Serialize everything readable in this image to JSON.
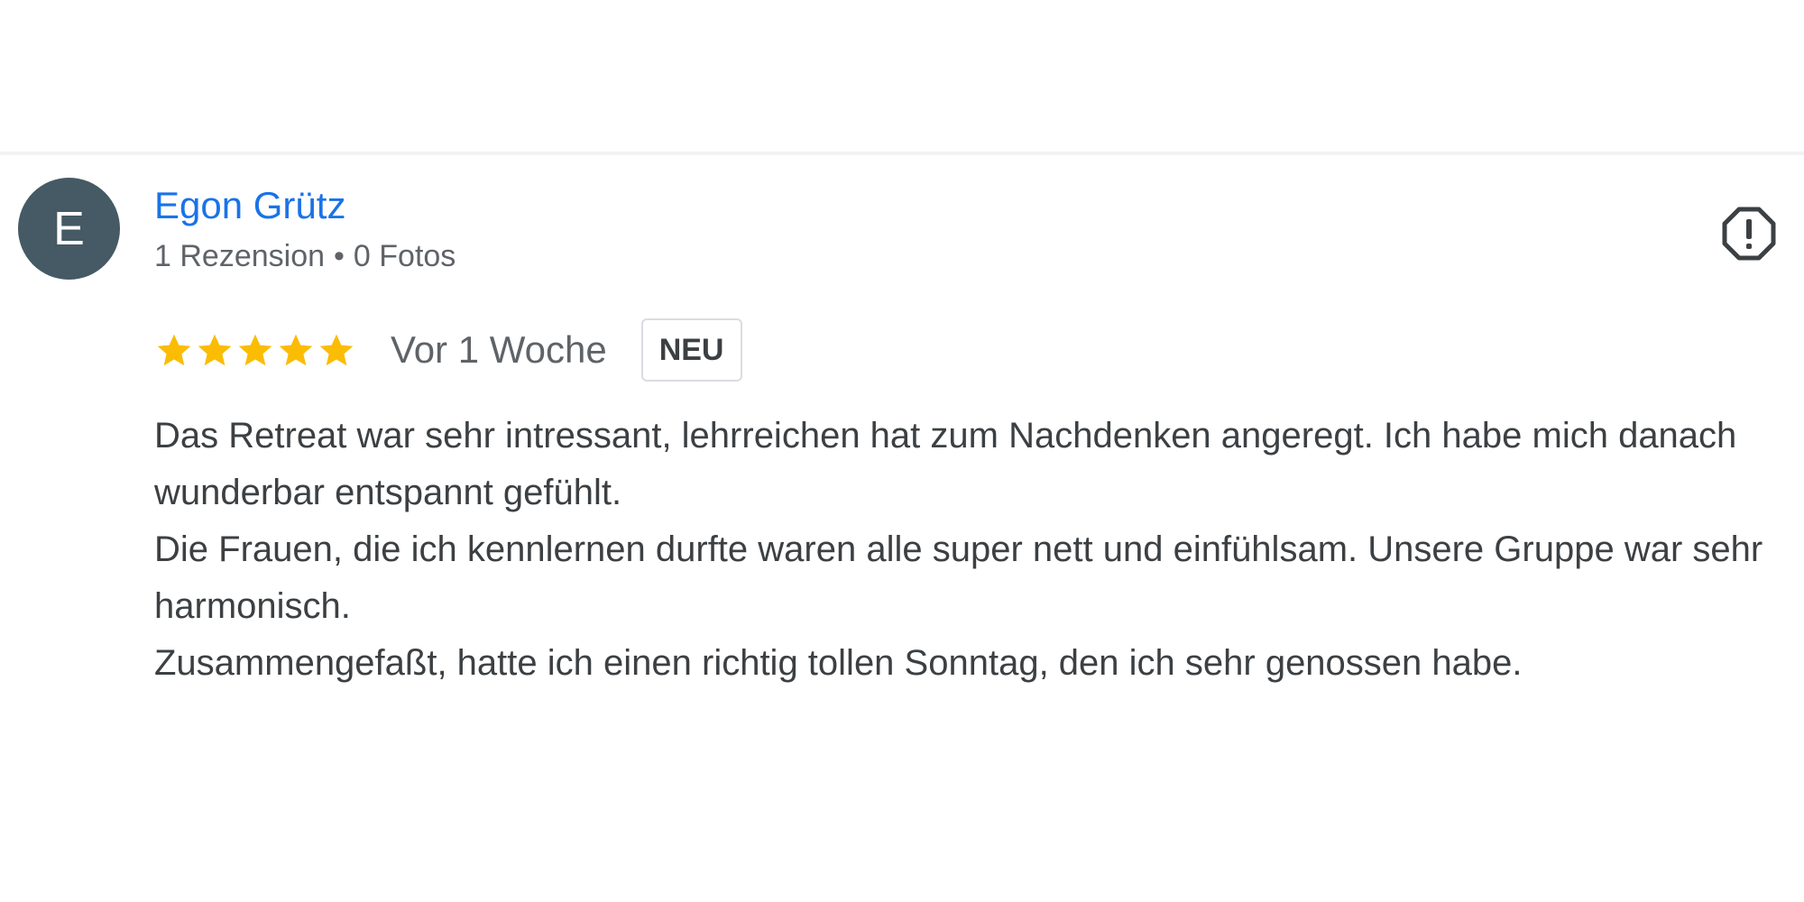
{
  "reviewer": {
    "initial": "E",
    "name": "Egon Grütz",
    "reviews_count": "1 Rezension",
    "separator": "•",
    "photos_count": "0 Fotos",
    "avatar_color": "#455a64"
  },
  "review": {
    "rating": 5,
    "max_rating": 5,
    "star_color": "#fbbc04",
    "date": "Vor 1 Woche",
    "badge": "NEU",
    "paragraphs": [
      "Das Retreat war sehr intressant, lehrreichen hat zum Nachdenken angeregt. Ich habe mich danach wunderbar entspannt gefühlt.",
      "Die Frauen, die ich kennlernen durfte waren alle super nett und einfühlsam. Unsere Gruppe war sehr harmonisch.",
      "Zusammengefaßt, hatte ich einen richtig tollen Sonntag, den ich sehr genossen habe."
    ]
  },
  "icons": {
    "flag": "report-flag-icon",
    "star": "star-icon"
  },
  "colors": {
    "link": "#1a73e8",
    "secondary_text": "#5f6368",
    "body_text": "#3c4043"
  }
}
